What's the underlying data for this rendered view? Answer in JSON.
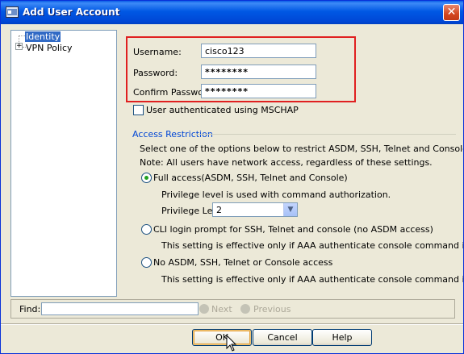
{
  "window": {
    "title": "Add User Account",
    "close_glyph": "✕"
  },
  "tree": {
    "items": [
      {
        "label": "Identity",
        "selected": true
      },
      {
        "label": "VPN Policy",
        "expander": "+"
      }
    ]
  },
  "credentials": {
    "username_label": "Username:",
    "username_value": "cisco123",
    "password_label": "Password:",
    "password_value": "********",
    "confirm_label": "Confirm Password:",
    "confirm_value": "********"
  },
  "mschap": {
    "label": "User authenticated using MSCHAP",
    "checked": false
  },
  "access": {
    "group_title": "Access Restriction",
    "intro_line1": "Select one of the options below to restrict ASDM, SSH, Telnet and Console access.",
    "intro_line2": "Note: All users have network access, regardless of these settings.",
    "option_full": "Full access(ASDM, SSH, Telnet and Console)",
    "full_desc": "Privilege level is used with command authorization.",
    "privilege_label": "Privilege Level:",
    "privilege_value": "2",
    "option_cli": "CLI login prompt for SSH, Telnet and console (no ASDM access)",
    "cli_desc": "This setting is effective only if AAA authenticate console command is configured.",
    "option_none": "No ASDM, SSH, Telnet or Console access",
    "none_desc": "This setting is effective only if AAA authenticate console command is configured.",
    "selected": "full"
  },
  "find": {
    "label": "Find:",
    "value": "",
    "next": "Next",
    "previous": "Previous"
  },
  "buttons": {
    "ok": "OK",
    "cancel": "Cancel",
    "help": "Help"
  },
  "colors": {
    "titlebar": "#0058e4",
    "highlight_box": "#e02020",
    "group_title": "#0046d5",
    "selection": "#316ac5"
  }
}
